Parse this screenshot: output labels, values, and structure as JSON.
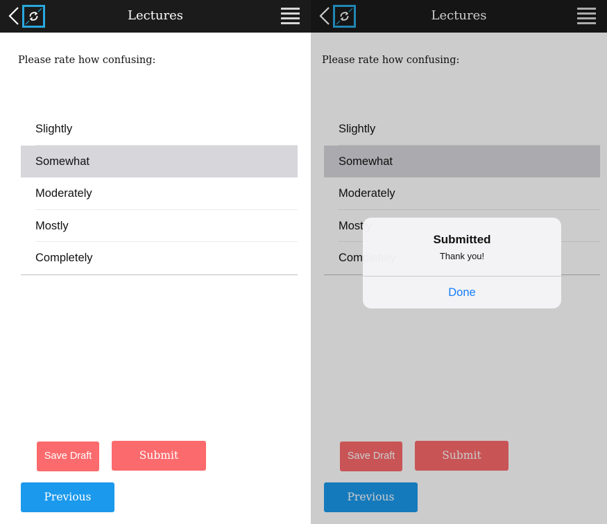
{
  "app": {
    "title": "Lectures"
  },
  "icons": {
    "back": "chevron-left-icon",
    "logo": "sync-logo-icon",
    "menu": "hamburger-menu-icon"
  },
  "colors": {
    "navbar": "#1b1b1b",
    "logo_accent": "#29a8e0",
    "action_red": "#fb6a6c",
    "previous_blue": "#1b99ec",
    "selected_row": "#d6d6db",
    "alert_link": "#157efb"
  },
  "survey": {
    "prompt": "Please rate how confusing:",
    "options": [
      "Slightly",
      "Somewhat",
      "Moderately",
      "Mostly",
      "Completely"
    ],
    "selected": "Somewhat"
  },
  "buttons": {
    "save_draft": "Save Draft",
    "submit": "Submit",
    "previous": "Previous"
  },
  "alert": {
    "title": "Submitted",
    "message": "Thank you!",
    "action": "Done"
  }
}
